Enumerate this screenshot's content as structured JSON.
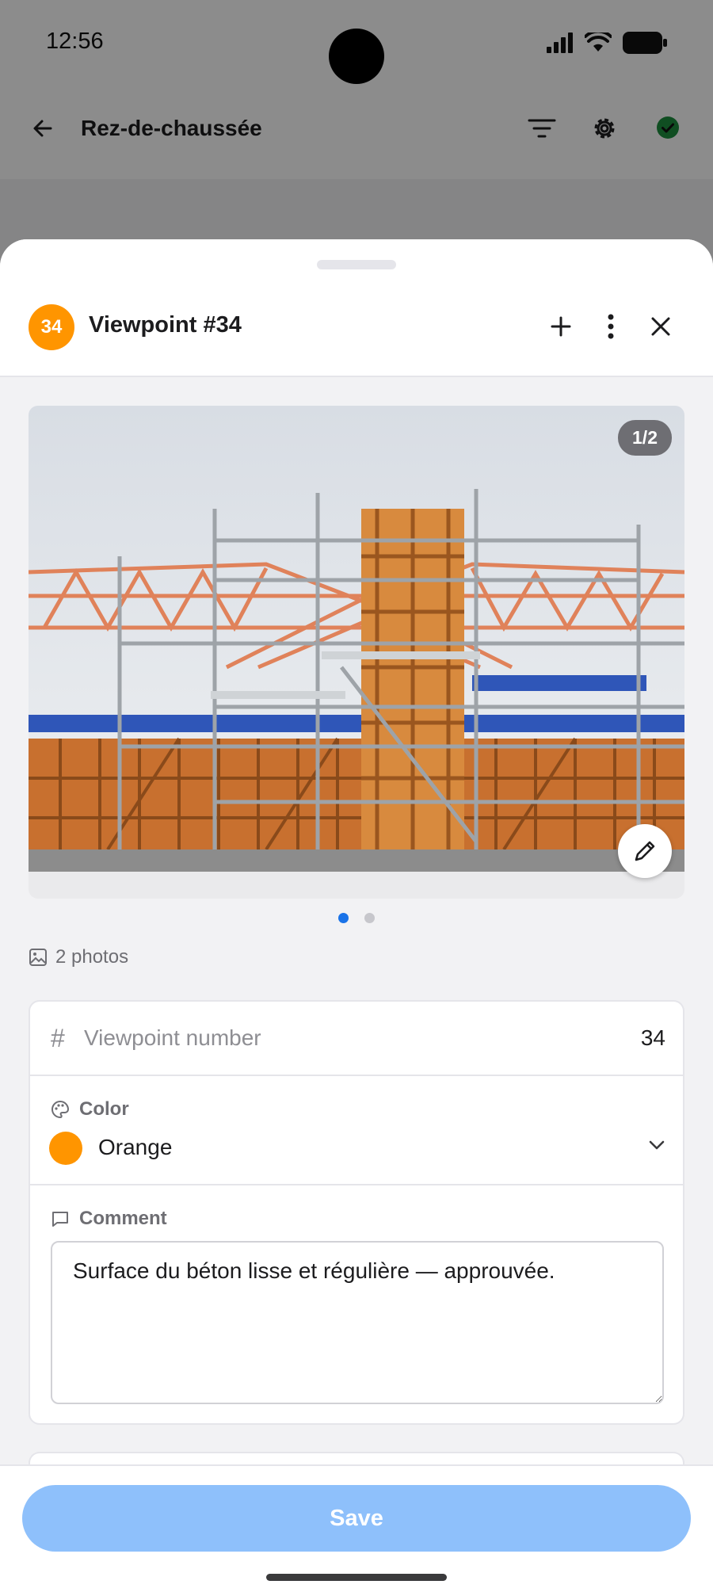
{
  "status_bar": {
    "time": "12:56"
  },
  "background_app": {
    "title": "Rez-de-chaussée"
  },
  "sheet": {
    "viewpoint_badge": "34",
    "title": "Viewpoint #34",
    "photo_counter": "1/2",
    "photos_count": "2 photos",
    "carousel": {
      "pages": 2,
      "active_page": 1
    },
    "fields": {
      "number_label": "Viewpoint number",
      "number_value": "34",
      "color_label": "Color",
      "color_value": "Orange",
      "comment_label": "Comment",
      "comment_value": "Surface du béton lisse et régulière — approuvée."
    },
    "save_label": "Save"
  },
  "colors": {
    "accent_orange": "#ff9500",
    "save_button": "#8ec0fb",
    "active_dot": "#1a73e8",
    "status_ok": "#1e8e3e"
  }
}
